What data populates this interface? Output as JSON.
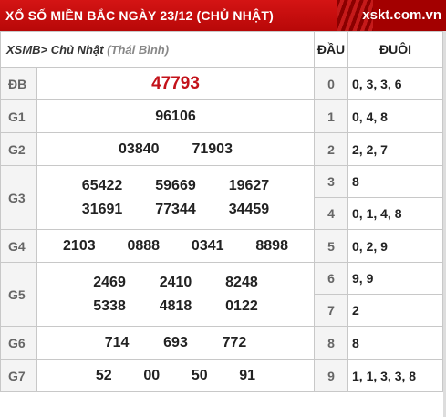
{
  "header": {
    "title": "XỔ SỐ MIỀN BẮC NGÀY 23/12 (CHỦ NHẬT)",
    "brand": "xskt.com.vn"
  },
  "table_header": {
    "region": "XSMB>",
    "day": "Chủ Nhật",
    "province": "(Thái Bình)",
    "dau_label": "ĐẦU",
    "duoi_label": "ĐUÔI"
  },
  "prizes": {
    "db": {
      "label": "ĐB",
      "numbers": [
        "47793"
      ]
    },
    "g1": {
      "label": "G1",
      "numbers": [
        "96106"
      ]
    },
    "g2": {
      "label": "G2",
      "numbers": [
        "03840",
        "71903"
      ]
    },
    "g3": {
      "label": "G3",
      "numbers": [
        "65422",
        "59669",
        "19627",
        "31691",
        "77344",
        "34459"
      ]
    },
    "g4": {
      "label": "G4",
      "numbers": [
        "2103",
        "0888",
        "0341",
        "8898"
      ]
    },
    "g5": {
      "label": "G5",
      "numbers": [
        "2469",
        "2410",
        "8248",
        "5338",
        "4818",
        "0122"
      ]
    },
    "g6": {
      "label": "G6",
      "numbers": [
        "714",
        "693",
        "772"
      ]
    },
    "g7": {
      "label": "G7",
      "numbers": [
        "52",
        "00",
        "50",
        "91"
      ]
    }
  },
  "loto": [
    {
      "dau": "0",
      "duoi": "0, 3, 3, 6"
    },
    {
      "dau": "1",
      "duoi": "0, 4, 8"
    },
    {
      "dau": "2",
      "duoi": "2, 2, 7"
    },
    {
      "dau": "3",
      "duoi": "8"
    },
    {
      "dau": "4",
      "duoi": "0, 1, 4, 8"
    },
    {
      "dau": "5",
      "duoi": "0, 2, 9"
    },
    {
      "dau": "6",
      "duoi": "9, 9"
    },
    {
      "dau": "7",
      "duoi": "2"
    },
    {
      "dau": "8",
      "duoi": "8"
    },
    {
      "dau": "9",
      "duoi": "1, 1, 3, 3, 8"
    }
  ]
}
